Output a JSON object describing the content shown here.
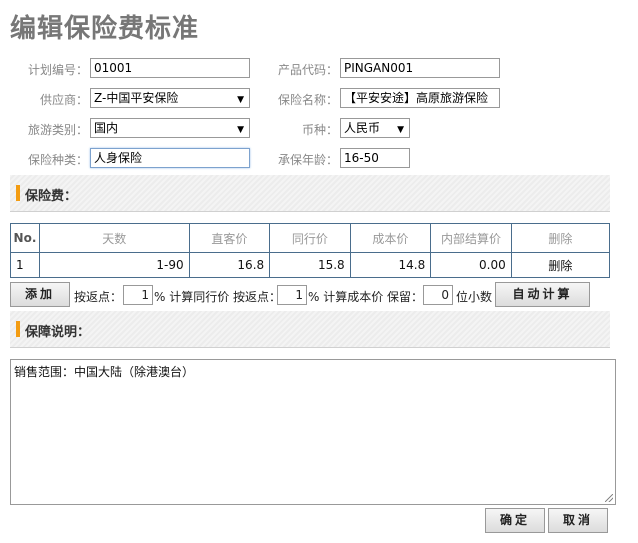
{
  "title": "编辑保险费标准",
  "form": {
    "plan_no": {
      "label": "计划编号：",
      "value": "01001"
    },
    "product_code": {
      "label": "产品代码：",
      "value": "PINGAN001"
    },
    "supplier": {
      "label": "供应商：",
      "value": "Z-中国平安保险"
    },
    "insurance_name": {
      "label": "保险名称：",
      "value": "【平安安途】高原旅游保险"
    },
    "travel_type": {
      "label": "旅游类别：",
      "value": "国内"
    },
    "currency": {
      "label": "币种：",
      "value": "人民币"
    },
    "insurance_kind": {
      "label": "保险种类：",
      "value": "人身保险"
    },
    "age_range": {
      "label": "承保年龄：",
      "value": "16-50"
    }
  },
  "section_fee": "保险费：",
  "table": {
    "headers": [
      "No.",
      "天数",
      "直客价",
      "同行价",
      "成本价",
      "内部结算价",
      "删除"
    ],
    "rows": [
      {
        "no": "1",
        "days": "1-90",
        "direct": "16.8",
        "peer": "15.8",
        "cost": "14.8",
        "internal": "0.00",
        "delete": "删除"
      }
    ]
  },
  "calc": {
    "add_label": "添加",
    "text1": "按返点：",
    "peer_rebate": "1",
    "text2": "% 计算同行价 按返点：",
    "cost_rebate": "1",
    "text3": "% 计算成本价 保留：",
    "decimals": "0",
    "text4": "位小数",
    "auto_label": "自动计算"
  },
  "section_desc": "保障说明：",
  "description": "销售范围：中国大陆（除港澳台）",
  "buttons": {
    "ok": "确定",
    "cancel": "取消"
  }
}
